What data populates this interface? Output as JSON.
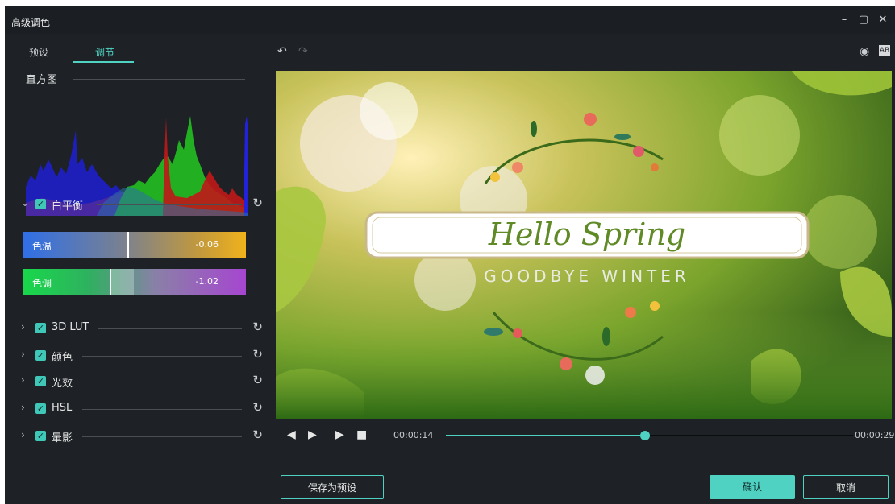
{
  "window": {
    "title": "高级调色",
    "controls": [
      "–",
      "▢",
      "✕"
    ]
  },
  "tabs": [
    {
      "label": "预设"
    },
    {
      "label": "调节"
    }
  ],
  "histogram": {
    "title": "直方图"
  },
  "white_balance": {
    "label": "白平衡",
    "temperature": {
      "label": "色温",
      "value": "-0.06",
      "level": 0.47
    },
    "tint": {
      "label": "色调",
      "value": "-1.02",
      "level": 0.39
    }
  },
  "sections": [
    {
      "label": "3D LUT"
    },
    {
      "label": "颜色"
    },
    {
      "label": "光效"
    },
    {
      "label": "HSL"
    },
    {
      "label": "暈影"
    }
  ],
  "preview": {
    "title_text": "Hello Spring",
    "subtitle_text": "GOODBYE WINTER"
  },
  "playback": {
    "current_time": "00:00:14",
    "total_time": "00:00:29",
    "progress": 0.49
  },
  "buttons": {
    "save_preset": "保存为预设",
    "ok": "确认",
    "cancel": "取消"
  },
  "icons": {
    "undo": "undo-icon",
    "redo": "redo-icon",
    "eye": "eye-icon",
    "compare": "compare-icon",
    "prev_frame": "prev-frame-icon",
    "next_frame": "next-frame-icon",
    "play": "play-icon",
    "stop": "stop-icon",
    "reset": "reset-icon",
    "chevron_down": "chevron-down-icon",
    "chevron_right": "chevron-right-icon",
    "check": "checkbox-icon"
  },
  "colors": {
    "accent": "#4fd2c2",
    "panel_bg": "#1e2226"
  }
}
